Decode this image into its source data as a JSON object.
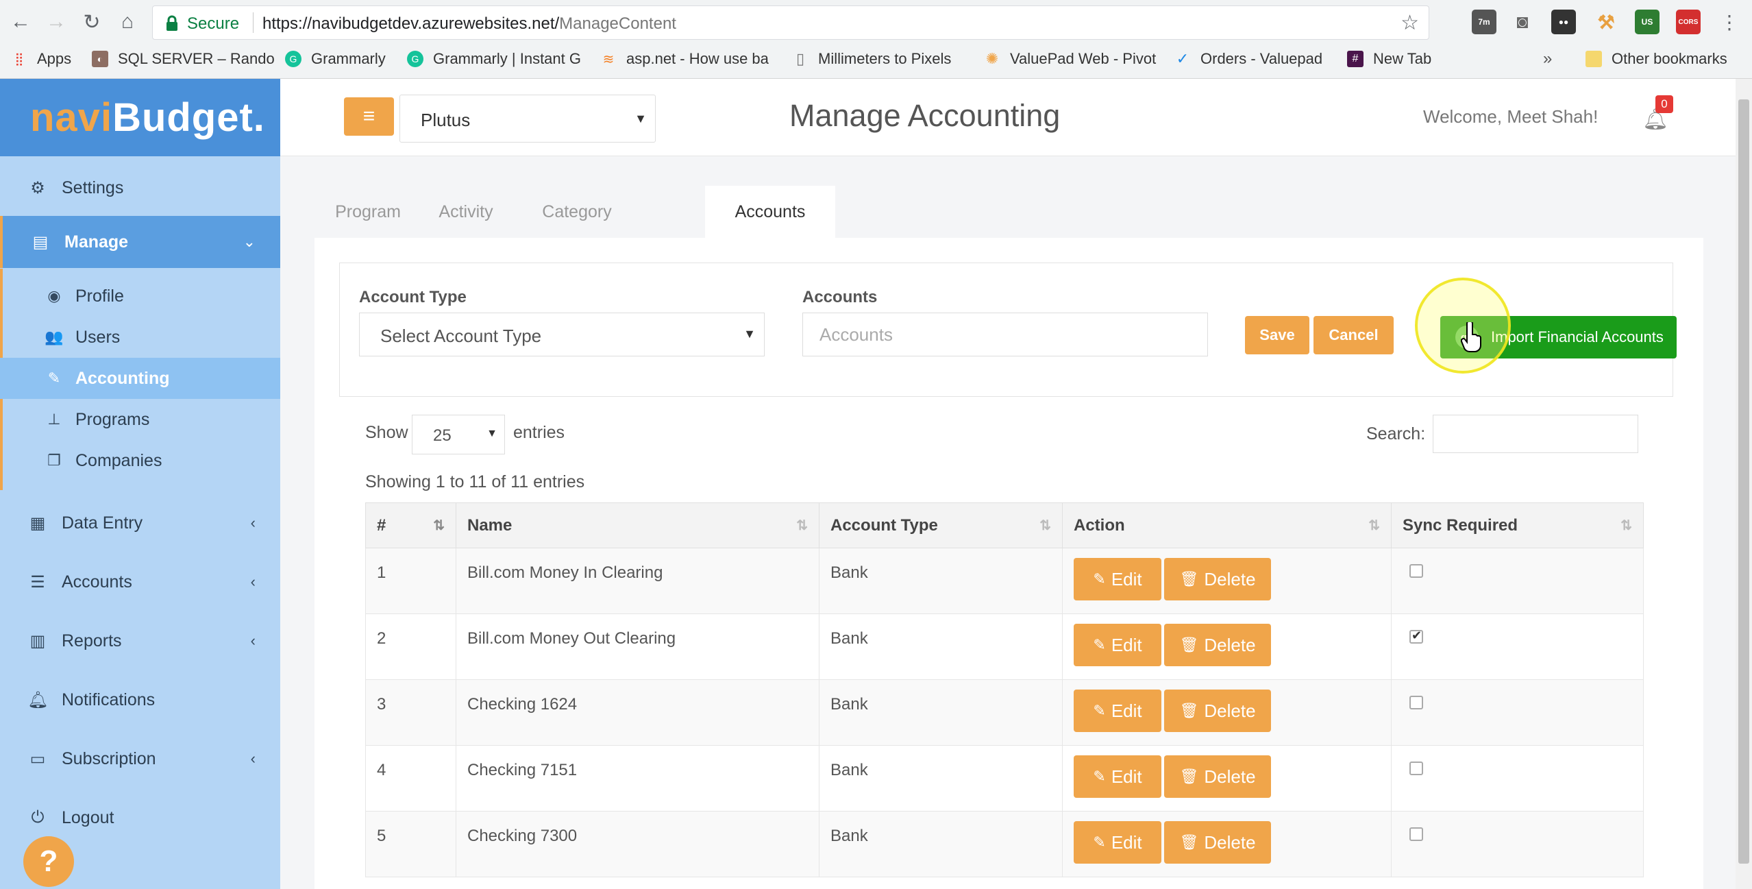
{
  "browser": {
    "secure_label": "Secure",
    "url_host": "https://navibudgetdev.azurewebsites.net/",
    "url_path": "ManageContent",
    "bookmarks": [
      {
        "label": "Apps"
      },
      {
        "label": "SQL SERVER – Rando"
      },
      {
        "label": "Grammarly"
      },
      {
        "label": "Grammarly | Instant G"
      },
      {
        "label": "asp.net - How use ba"
      },
      {
        "label": "Millimeters to Pixels"
      },
      {
        "label": "ValuePad Web - Pivot"
      },
      {
        "label": "Orders - Valuepad"
      },
      {
        "label": "New Tab"
      },
      {
        "label": "Other bookmarks"
      }
    ],
    "extension_labels": {
      "clock": "7m",
      "globe": "US",
      "cors": "CORS"
    }
  },
  "app": {
    "logo_part1": "navi",
    "logo_part2": "Budget.",
    "company": "Plutus",
    "page_title": "Manage Accounting",
    "welcome": "Welcome, Meet Shah!",
    "notification_count": "0"
  },
  "sidebar": {
    "items": [
      {
        "label": "Settings",
        "icon": "gears-icon"
      },
      {
        "label": "Manage",
        "icon": "window-icon"
      },
      {
        "label": "Profile",
        "icon": "user-circle-icon"
      },
      {
        "label": "Users",
        "icon": "users-icon"
      },
      {
        "label": "Accounting",
        "icon": "edit-icon"
      },
      {
        "label": "Programs",
        "icon": "sitemap-icon"
      },
      {
        "label": "Companies",
        "icon": "clone-icon"
      },
      {
        "label": "Data Entry",
        "icon": "table-icon"
      },
      {
        "label": "Accounts",
        "icon": "list-icon"
      },
      {
        "label": "Reports",
        "icon": "bar-chart-icon"
      },
      {
        "label": "Notifications",
        "icon": "bell-icon"
      },
      {
        "label": "Subscription",
        "icon": "credit-card-icon"
      },
      {
        "label": "Logout",
        "icon": "power-icon"
      }
    ]
  },
  "tabs": [
    "Program",
    "Activity",
    "Category",
    "Accounts"
  ],
  "form": {
    "account_type_label": "Account Type",
    "account_type_value": "Select Account Type",
    "accounts_label": "Accounts",
    "accounts_placeholder": "Accounts",
    "save_label": "Save",
    "cancel_label": "Cancel",
    "import_label": "Import Financial Accounts"
  },
  "table_controls": {
    "show_label": "Show",
    "page_length": "25",
    "entries_label": "entries",
    "search_label": "Search:",
    "info": "Showing 1 to 11 of 11 entries"
  },
  "table": {
    "columns": [
      "#",
      "Name",
      "Account Type",
      "Action",
      "Sync Required"
    ],
    "edit_label": "Edit",
    "delete_label": "Delete",
    "rows": [
      {
        "num": "1",
        "name": "Bill.com Money In Clearing",
        "type": "Bank",
        "sync": false
      },
      {
        "num": "2",
        "name": "Bill.com Money Out Clearing",
        "type": "Bank",
        "sync": true
      },
      {
        "num": "3",
        "name": "Checking 1624",
        "type": "Bank",
        "sync": false
      },
      {
        "num": "4",
        "name": "Checking 7151",
        "type": "Bank",
        "sync": false
      },
      {
        "num": "5",
        "name": "Checking 7300",
        "type": "Bank",
        "sync": false
      }
    ]
  },
  "colors": {
    "accent_orange": "#f0a54a",
    "import_green": "#1a9c1a",
    "sidebar_bg": "#b4d5f5",
    "logo_bg": "#4a90d9"
  }
}
